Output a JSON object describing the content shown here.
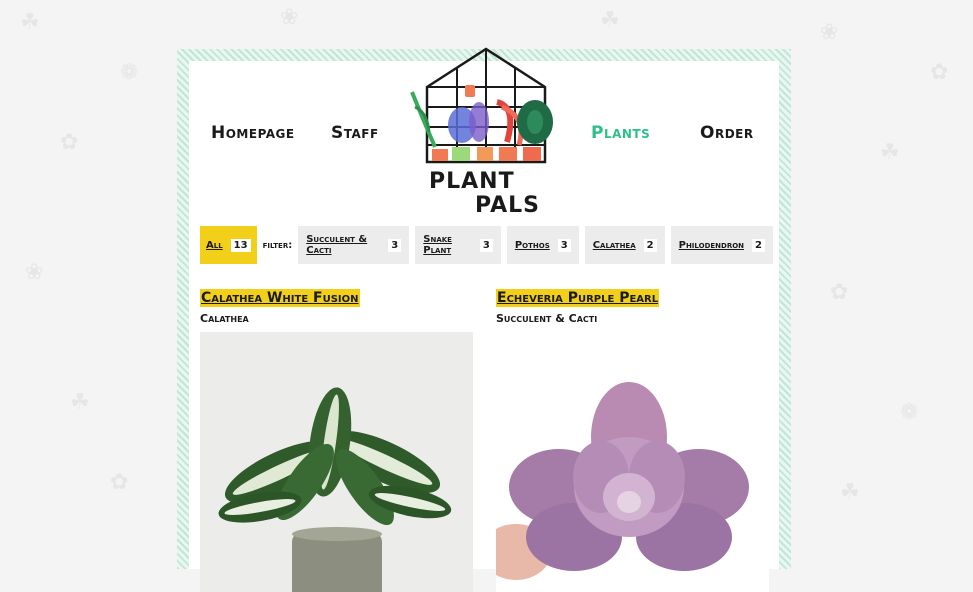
{
  "nav": {
    "homepage": "Homepage",
    "staff": "Staff",
    "plants": "Plants",
    "order": "Order"
  },
  "logo": {
    "line1": "PLANT",
    "line2": "PALS"
  },
  "filters": {
    "all": {
      "label": "All",
      "count": "13"
    },
    "label": "filter:",
    "items": [
      {
        "label": "Succulent & Cacti",
        "count": "3"
      },
      {
        "label": "Snake Plant",
        "count": "3"
      },
      {
        "label": "Pothos",
        "count": "3"
      },
      {
        "label": "Calathea",
        "count": "2"
      },
      {
        "label": "Philodendron",
        "count": "2"
      }
    ]
  },
  "plants": [
    {
      "name": "Calathea White Fusion",
      "category": "Calathea"
    },
    {
      "name": "Echeveria Purple Pearl",
      "category": "Succulent & Cacti"
    }
  ],
  "colors": {
    "accent_yellow": "#f2cf18",
    "active_green": "#2fbf8a",
    "frame_green": "#bfe6d6"
  }
}
